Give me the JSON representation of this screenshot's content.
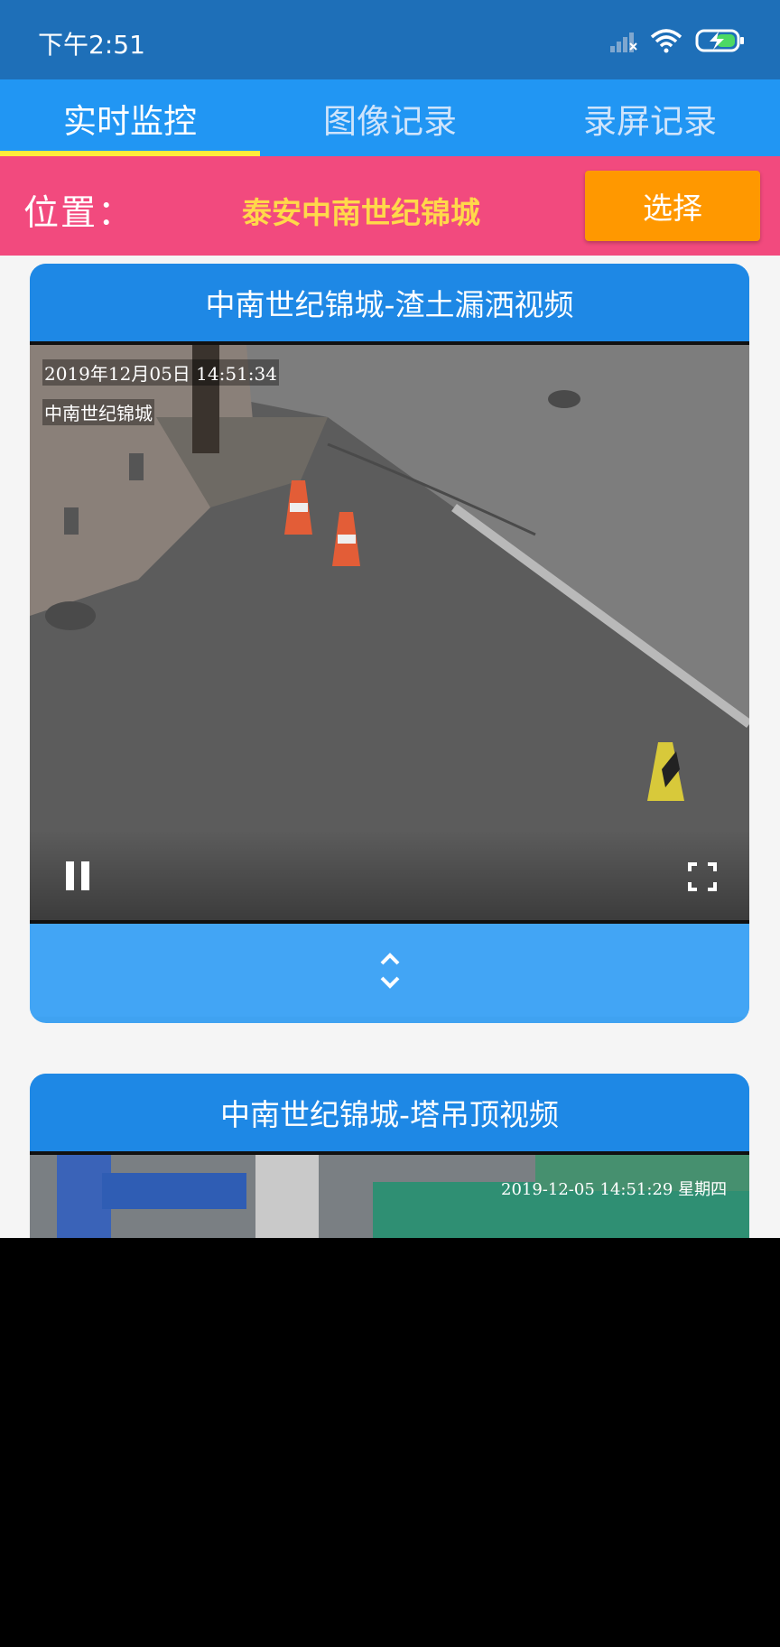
{
  "status": {
    "time": "下午2:51"
  },
  "tabs": [
    {
      "label": "实时监控",
      "active": true
    },
    {
      "label": "图像记录",
      "active": false
    },
    {
      "label": "录屏记录",
      "active": false
    }
  ],
  "location": {
    "label": "位置：",
    "value": "泰安中南世纪锦城",
    "select_label": "选择"
  },
  "cameras": [
    {
      "title": "中南世纪锦城-渣土漏洒视频",
      "osd_time": "2019年12月05日 14:51:34",
      "osd_name": "中南世纪锦城",
      "playing": true,
      "icons": [
        "pause-icon",
        "fullscreen-icon",
        "expand-collapse-icon"
      ]
    },
    {
      "title": "中南世纪锦城-塔吊顶视频",
      "osd_time": "2019-12-05 14:51:29 星期四"
    }
  ],
  "colors": {
    "status_bar": "#1e6fb8",
    "tab_bar": "#2196f3",
    "tab_indicator": "#ffeb3b",
    "location_bar": "#f24a7e",
    "location_value": "#ffd84a",
    "select_button": "#ff9800",
    "card_header": "#1e88e5",
    "card_footer": "#42a5f5"
  }
}
